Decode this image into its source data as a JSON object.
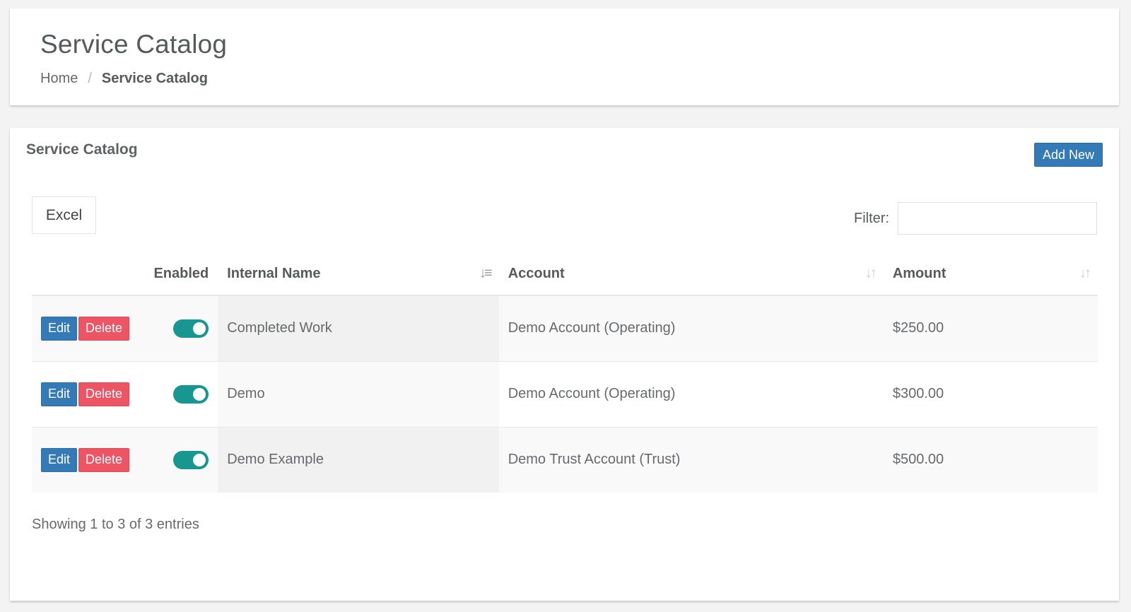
{
  "header": {
    "title": "Service Catalog",
    "breadcrumb": {
      "home": "Home",
      "separator": "/",
      "current": "Service Catalog"
    }
  },
  "panel": {
    "title": "Service Catalog",
    "add_new_label": "Add New",
    "excel_label": "Excel",
    "filter_label": "Filter:",
    "filter_value": ""
  },
  "table": {
    "columns": {
      "enabled": "Enabled",
      "internal_name": "Internal Name",
      "account": "Account",
      "amount": "Amount"
    },
    "edit_label": "Edit",
    "delete_label": "Delete",
    "rows": [
      {
        "enabled": true,
        "internal_name": "Completed Work",
        "account": "Demo Account (Operating)",
        "amount": "$250.00"
      },
      {
        "enabled": true,
        "internal_name": "Demo",
        "account": "Demo Account (Operating)",
        "amount": "$300.00"
      },
      {
        "enabled": true,
        "internal_name": "Demo Example",
        "account": "Demo Trust Account (Trust)",
        "amount": "$500.00"
      }
    ]
  },
  "footer": {
    "info": "Showing 1 to 3 of 3 entries"
  },
  "colors": {
    "primary": "#337ab7",
    "danger": "#ed5565",
    "toggle_on": "#17978f"
  },
  "icons": {
    "sort_active": "sort-amount-down-icon",
    "sort_inactive": "sort-icon"
  }
}
